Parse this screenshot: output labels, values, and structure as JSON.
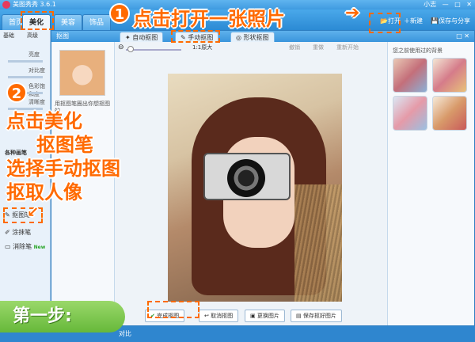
{
  "window": {
    "title": "美图秀秀 3.6.1",
    "controls": [
      "小志",
      "—",
      "□",
      "✕"
    ]
  },
  "toolbar": {
    "tabs": [
      "首页",
      "美化",
      "美容",
      "饰品"
    ],
    "open_label": "打开",
    "new_label": "新建",
    "save_label": "保存与分享"
  },
  "left_rail": {
    "tabs": [
      "基础",
      "高级"
    ],
    "sliders": [
      "亮度",
      "对比度",
      "色彩饱和度",
      "清晰度"
    ],
    "section_title": "各种画笔",
    "tools": [
      "抠图笔",
      "涂抹笔",
      "消除笔"
    ],
    "new_badge": "New"
  },
  "subbar": {
    "title": "抠图",
    "tabs": [
      "自动抠图",
      "手动抠图",
      "形状抠图"
    ]
  },
  "left_panel": {
    "hint": "用抠图笔圈出你想抠图的"
  },
  "canvas_toolbar": {
    "zoom_label": "1:1原大",
    "undo_label": "撤销",
    "redo_label": "重做",
    "reset_label": "重新开始"
  },
  "canvas_bottom": {
    "buttons": [
      "完成抠图",
      "取消抠图",
      "更换图片",
      "保存抠好图片"
    ]
  },
  "right_panel": {
    "title": "您之前使用过的背景"
  },
  "status": {
    "text": "对比"
  },
  "annotations": {
    "step1_num": "1",
    "step1_text": "点击打开一张照片",
    "step2_num": "2",
    "step2_lines": [
      "点击美化",
      "抠图笔",
      "选择手动抠图",
      "抠取人像"
    ],
    "step_label": "第一步:"
  },
  "colors": {
    "accent": "#ff6a00",
    "bar_blue": "#2b8ad4",
    "step_green": "#66b83a"
  }
}
